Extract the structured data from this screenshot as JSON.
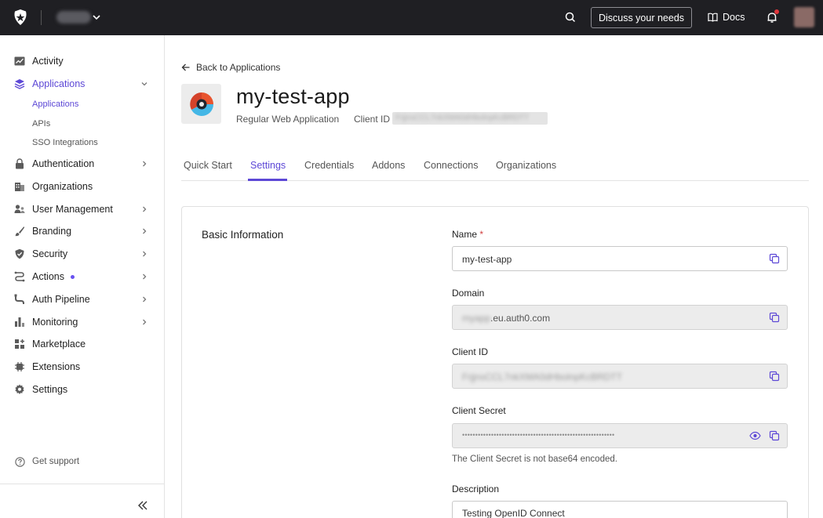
{
  "topbar": {
    "tenant_name": "tenant",
    "discuss_label": "Discuss your needs",
    "docs_label": "Docs"
  },
  "sidebar": {
    "items": [
      {
        "label": "Activity"
      },
      {
        "label": "Applications"
      },
      {
        "label": "Authentication"
      },
      {
        "label": "Organizations"
      },
      {
        "label": "User Management"
      },
      {
        "label": "Branding"
      },
      {
        "label": "Security"
      },
      {
        "label": "Actions"
      },
      {
        "label": "Auth Pipeline"
      },
      {
        "label": "Monitoring"
      },
      {
        "label": "Marketplace"
      },
      {
        "label": "Extensions"
      },
      {
        "label": "Settings"
      }
    ],
    "sub_items": [
      {
        "label": "Applications"
      },
      {
        "label": "APIs"
      },
      {
        "label": "SSO Integrations"
      }
    ],
    "support_label": "Get support"
  },
  "main": {
    "back_label": "Back to Applications",
    "app_name": "my-test-app",
    "app_type": "Regular Web Application",
    "client_id_label": "Client ID",
    "client_id_value": "FrjjnsCCL7nkXMA0dHbolnpKcBRDTT",
    "tabs": [
      {
        "label": "Quick Start"
      },
      {
        "label": "Settings"
      },
      {
        "label": "Credentials"
      },
      {
        "label": "Addons"
      },
      {
        "label": "Connections"
      },
      {
        "label": "Organizations"
      }
    ],
    "active_tab": "Settings",
    "section_title": "Basic Information",
    "fields": {
      "name_label": "Name",
      "name_required": "*",
      "name_value": "my-test-app",
      "domain_label": "Domain",
      "domain_prefix": "myapp",
      "domain_suffix": ".eu.auth0.com",
      "client_id_label": "Client ID",
      "client_id_value": "FrjjnsCCL7nkXMA0dHbolnpKcBRDTT",
      "client_secret_label": "Client Secret",
      "client_secret_mask": "••••••••••••••••••••••••••••••••••••••••••••••••••••••••••",
      "client_secret_hint": "The Client Secret is not base64 encoded.",
      "description_label": "Description",
      "description_value": "Testing OpenID Connect"
    }
  },
  "colors": {
    "accent": "#5d48d6",
    "topbar": "#1f1f23"
  }
}
